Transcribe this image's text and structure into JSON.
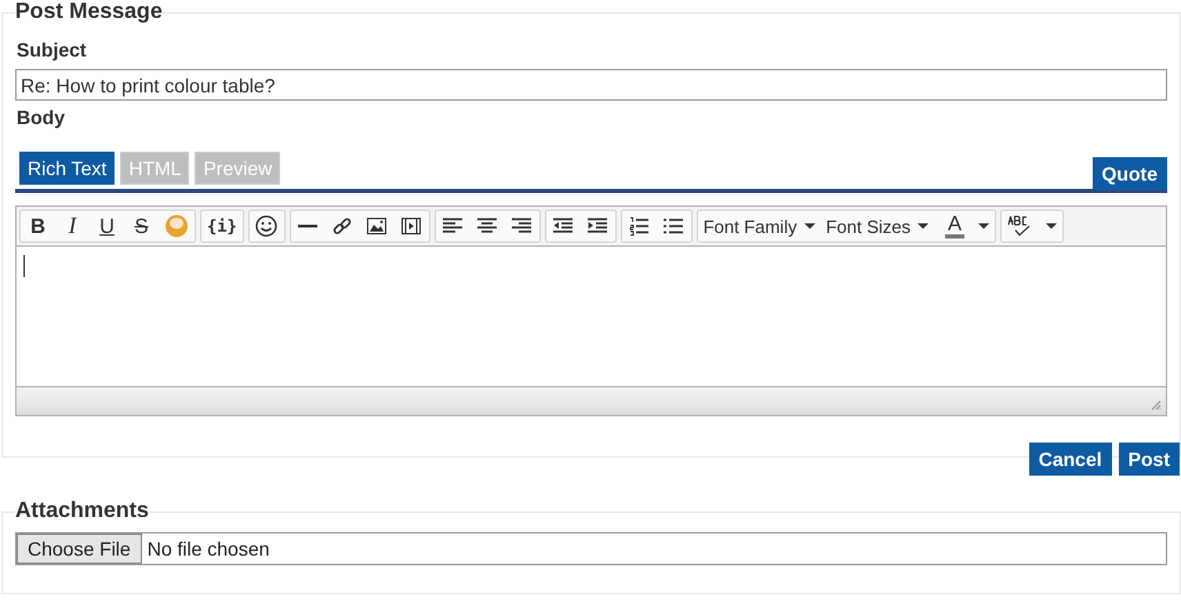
{
  "form": {
    "legend": "Post Message",
    "subject_label": "Subject",
    "subject_value": "Re: How to print colour table?",
    "body_label": "Body"
  },
  "tabs": [
    {
      "label": "Rich Text",
      "selected": true
    },
    {
      "label": "HTML",
      "selected": false
    },
    {
      "label": "Preview",
      "selected": false
    }
  ],
  "quote_button": "Quote",
  "toolbar": {
    "bold": "B",
    "italic": "I",
    "underline": "U",
    "strike": "S",
    "code": "{i}",
    "font_family": "Font Family",
    "font_sizes": "Font Sizes",
    "text_color": "A"
  },
  "buttons": [
    "Cancel",
    "Post"
  ],
  "attachments": {
    "legend": "Attachments",
    "choose_button": "Choose File",
    "status": "No file chosen"
  }
}
